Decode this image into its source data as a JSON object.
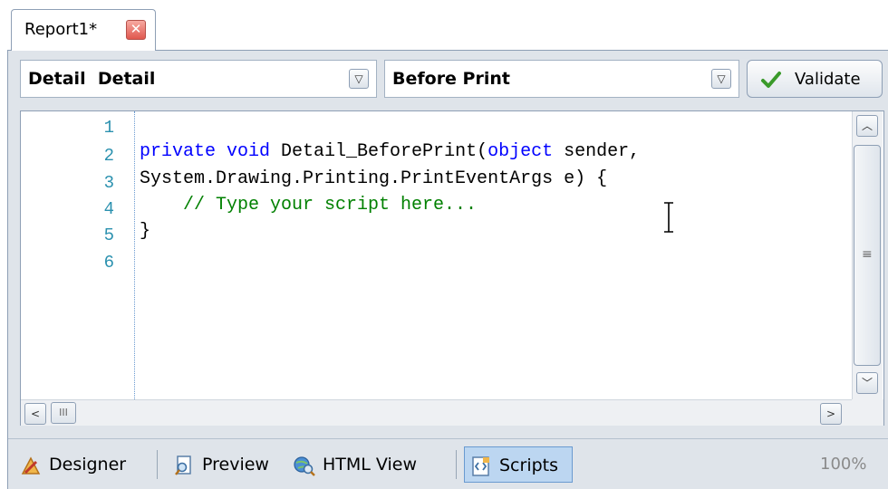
{
  "document_tab": {
    "label": "Report1*"
  },
  "toolbar": {
    "component_combo": "Detail  Detail",
    "event_combo": "Before Print",
    "validate_label": "Validate"
  },
  "editor": {
    "line_numbers": [
      "1",
      "2",
      "3",
      "4",
      "5",
      "6"
    ],
    "lines": [
      [],
      [
        {
          "t": "private void",
          "c": "kw"
        },
        {
          "t": " Detail_BeforePrint(",
          "c": ""
        },
        {
          "t": "object",
          "c": "kw"
        },
        {
          "t": " sender,",
          "c": ""
        }
      ],
      [
        {
          "t": "System.Drawing.Printing.PrintEventArgs e) {",
          "c": ""
        }
      ],
      [
        {
          "t": "    // Type your script here...",
          "c": "cm"
        }
      ],
      [
        {
          "t": "}",
          "c": ""
        }
      ],
      []
    ]
  },
  "view_bar": {
    "buttons": [
      {
        "label": "Designer",
        "icon": "designer-icon"
      },
      {
        "label": "Preview",
        "icon": "preview-icon"
      },
      {
        "label": "HTML View",
        "icon": "html-view-icon"
      },
      {
        "label": "Scripts",
        "icon": "scripts-icon",
        "active": true
      }
    ],
    "zoom": "100%"
  },
  "colors": {
    "keyword": "#0000ff",
    "comment": "#008000",
    "line_number": "#2b91af",
    "active_tab": "#bcd6f1"
  }
}
